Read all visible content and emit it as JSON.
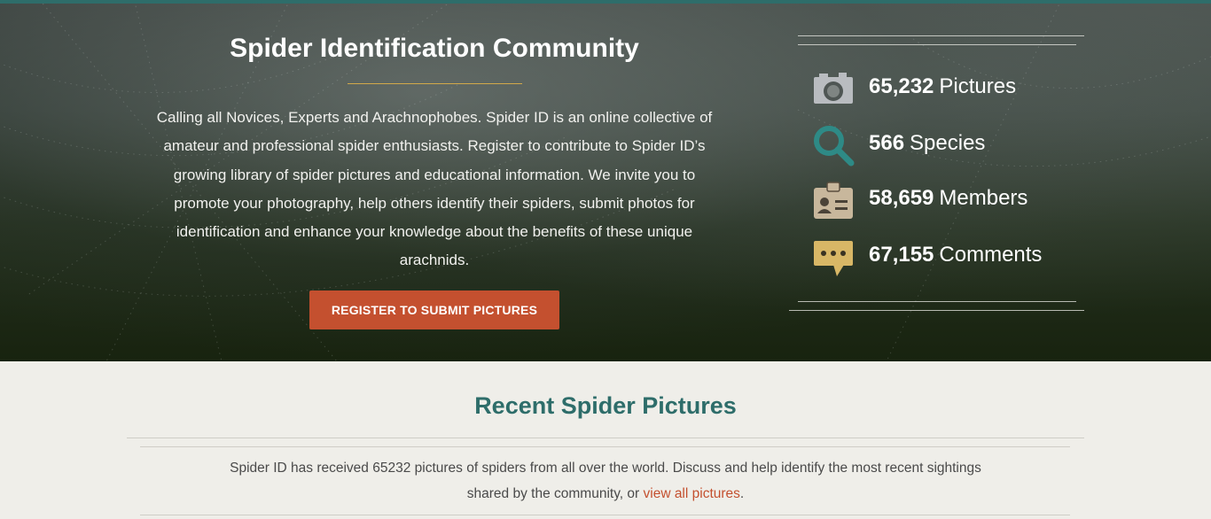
{
  "hero": {
    "title": "Spider Identification Community",
    "description": "Calling all Novices, Experts and Arachnophobes. Spider ID is an online collective of amateur and professional spider enthusiasts. Register to contribute to Spider ID’s growing library of spider pictures and educational information. We invite you to promote your photography, help others identify their spiders, submit photos for identification and enhance your knowledge about the benefits of these unique arachnids.",
    "register_button": "REGISTER TO SUBMIT PICTURES"
  },
  "stats": [
    {
      "icon": "camera-icon",
      "value": "65,232",
      "label": "Pictures",
      "color": "#b9bcc0"
    },
    {
      "icon": "magnifier-icon",
      "value": "566",
      "label": "Species",
      "color": "#2e8a86"
    },
    {
      "icon": "id-badge-icon",
      "value": "58,659",
      "label": "Members",
      "color": "#c8b79c"
    },
    {
      "icon": "speech-bubble-icon",
      "value": "67,155",
      "label": "Comments",
      "color": "#d8b766"
    }
  ],
  "recent": {
    "title": "Recent Spider Pictures",
    "text_before": "Spider ID has received 65232 pictures of spiders from all over the world. Discuss and help identify the most recent sightings shared by the community, or ",
    "link_text": "view all pictures",
    "text_after": "."
  },
  "colors": {
    "accent": "#2e6d6a",
    "button": "#c4502f",
    "link": "#c4502f",
    "title_underline": "#d2a94a",
    "page_background": "#efeee9"
  }
}
